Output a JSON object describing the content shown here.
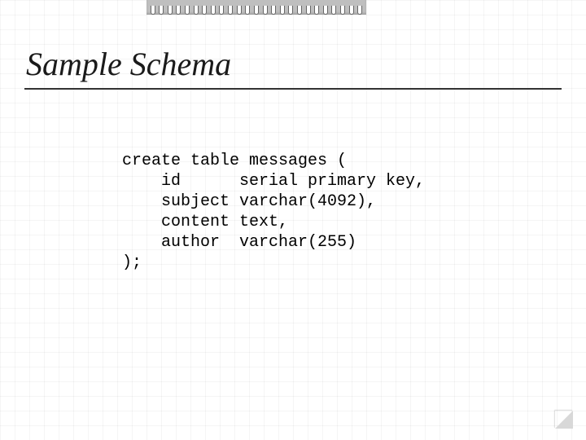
{
  "slide": {
    "title": "Sample Schema",
    "code_lines": [
      "create table messages (",
      "    id      serial primary key,",
      "    subject varchar(4092),",
      "    content text,",
      "    author  varchar(255)",
      ");"
    ]
  }
}
